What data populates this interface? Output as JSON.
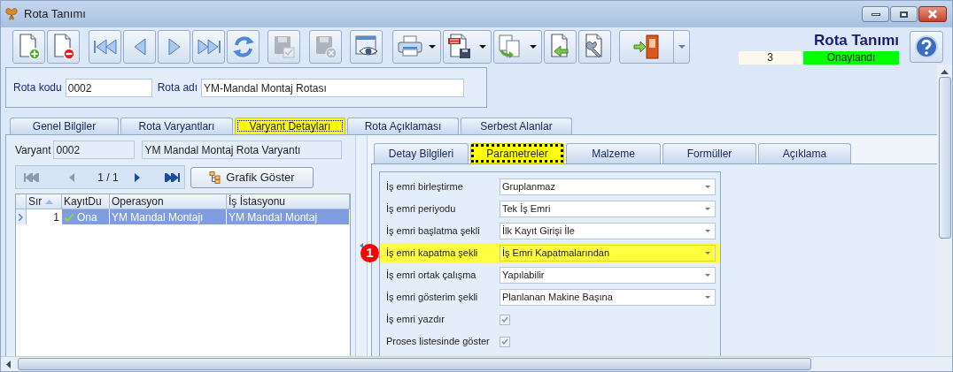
{
  "window": {
    "title": "Rota Tanımı"
  },
  "toolbar": [
    {
      "kind": "new",
      "disabled": false,
      "dropdown": false
    },
    {
      "kind": "delete",
      "disabled": false,
      "dropdown": false
    },
    {
      "kind": "first",
      "disabled": false,
      "dropdown": false
    },
    {
      "kind": "prev",
      "disabled": false,
      "dropdown": false
    },
    {
      "kind": "next",
      "disabled": false,
      "dropdown": false
    },
    {
      "kind": "last",
      "disabled": false,
      "dropdown": false
    },
    {
      "kind": "refresh",
      "disabled": false,
      "dropdown": false
    },
    {
      "kind": "save",
      "disabled": true,
      "dropdown": false
    },
    {
      "kind": "cancel",
      "disabled": true,
      "dropdown": false
    },
    {
      "kind": "preview",
      "disabled": false,
      "dropdown": false
    },
    {
      "kind": "print",
      "disabled": false,
      "dropdown": true
    },
    {
      "kind": "pdf",
      "disabled": false,
      "dropdown": true
    },
    {
      "kind": "copy",
      "disabled": false,
      "dropdown": true
    },
    {
      "kind": "import",
      "disabled": false,
      "dropdown": false
    },
    {
      "kind": "tools",
      "disabled": false,
      "dropdown": false
    },
    {
      "kind": "exit",
      "disabled": false,
      "dropdown": true
    }
  ],
  "header": {
    "title": "Rota Tanımı",
    "record_no": "3",
    "status": "Onaylandı"
  },
  "fields": [
    {
      "label": "Rota kodu",
      "value": "0002"
    },
    {
      "label": "Rota adı",
      "value": "YM-Mandal Montaj Rotası"
    }
  ],
  "tabs": [
    {
      "label": "Genel Bilgiler",
      "selected": false
    },
    {
      "label": "Rota Varyantları",
      "selected": false
    },
    {
      "label": "Varyant Detayları",
      "selected": true
    },
    {
      "label": "Rota Açıklaması",
      "selected": false
    },
    {
      "label": "Serbest Alanlar",
      "selected": false
    }
  ],
  "variant": {
    "label": "Varyant",
    "code": "0002",
    "name": "YM Mandal Montaj Rota Varyantı"
  },
  "navigator": {
    "position": "1 / 1"
  },
  "graph_button": "Grafik Göster",
  "grid": {
    "columns": [
      {
        "label": "Sır",
        "sorted": true
      },
      {
        "label": "KayıtDu",
        "sorted": false
      },
      {
        "label": "Operasyon",
        "sorted": false
      },
      {
        "label": "İş İstasyonu",
        "sorted": false
      }
    ],
    "rows": [
      {
        "selected": true,
        "cells": [
          "1",
          "Ona",
          "YM Mandal Montajı",
          "YM Mandal Montaj"
        ]
      }
    ]
  },
  "sub_tabs": [
    {
      "label": "Detay Bilgileri",
      "selected": false
    },
    {
      "label": "Parametreler",
      "selected": true
    },
    {
      "label": "Malzeme",
      "selected": false
    },
    {
      "label": "Formüller",
      "selected": false
    },
    {
      "label": "Açıklama",
      "selected": false
    }
  ],
  "params": [
    {
      "kind": "dropdown",
      "label": "İş emri birleştirme",
      "value": "Gruplanmaz",
      "highlighted": false
    },
    {
      "kind": "dropdown",
      "label": "İş emri periyodu",
      "value": "Tek İş Emri",
      "highlighted": false
    },
    {
      "kind": "dropdown",
      "label": "İş emri başlatma şekli",
      "value": "İlk Kayıt Girişi İle",
      "highlighted": false
    },
    {
      "kind": "dropdown",
      "label": "İş emri kapatma şekli",
      "value": "İş Emri Kapatmalarından",
      "highlighted": true,
      "badge": "1"
    },
    {
      "kind": "dropdown",
      "label": "İş emri ortak çalışma",
      "value": "Yapılabilir",
      "highlighted": false
    },
    {
      "kind": "dropdown",
      "label": "İş emri gösterim şekli",
      "value": "Planlanan Makine Başına",
      "highlighted": false
    },
    {
      "kind": "checkbox",
      "label": "İş emri yazdır",
      "checked": true,
      "highlighted": false
    },
    {
      "kind": "checkbox",
      "label": "Proses listesinde göster",
      "checked": true,
      "highlighted": false
    }
  ]
}
